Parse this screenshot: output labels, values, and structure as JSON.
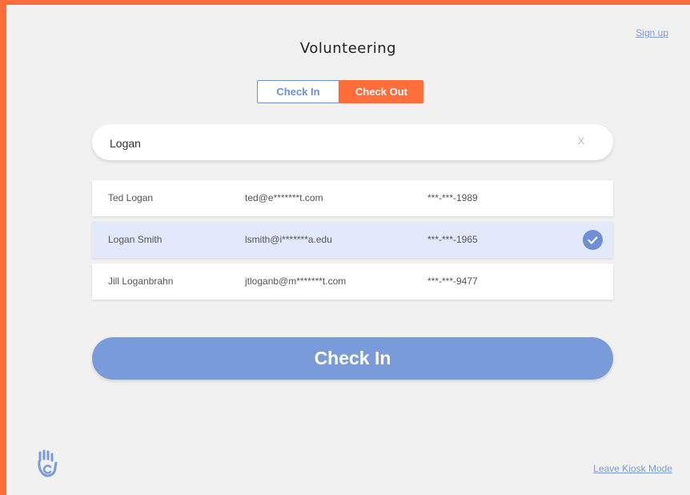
{
  "header": {
    "title": "Volunteering",
    "signup_link": "Sign up"
  },
  "mode_toggle": {
    "check_in_label": "Check In",
    "check_out_label": "Check Out",
    "active": "Check Out"
  },
  "search": {
    "value": "Logan",
    "clear_label": "X"
  },
  "results": [
    {
      "name": "Ted Logan",
      "email": "ted@e*******t.com",
      "phone": "***-***-1989",
      "selected": false
    },
    {
      "name": "Logan Smith",
      "email": "lsmith@i*******a.edu",
      "phone": "***-***-1965",
      "selected": true
    },
    {
      "name": "Jill Loganbrahn",
      "email": "jtloganb@m*******t.com",
      "phone": "***-***-9477",
      "selected": false
    }
  ],
  "primary_action": {
    "label": "Check In"
  },
  "footer": {
    "logo_icon": "hand-c-logo-icon",
    "leave_kiosk_link": "Leave Kiosk Mode"
  },
  "colors": {
    "accent_orange": "#ff6d3b",
    "accent_blue": "#7a9bda",
    "selected_row": "#e1e9fb",
    "background": "#f1f1f1"
  }
}
